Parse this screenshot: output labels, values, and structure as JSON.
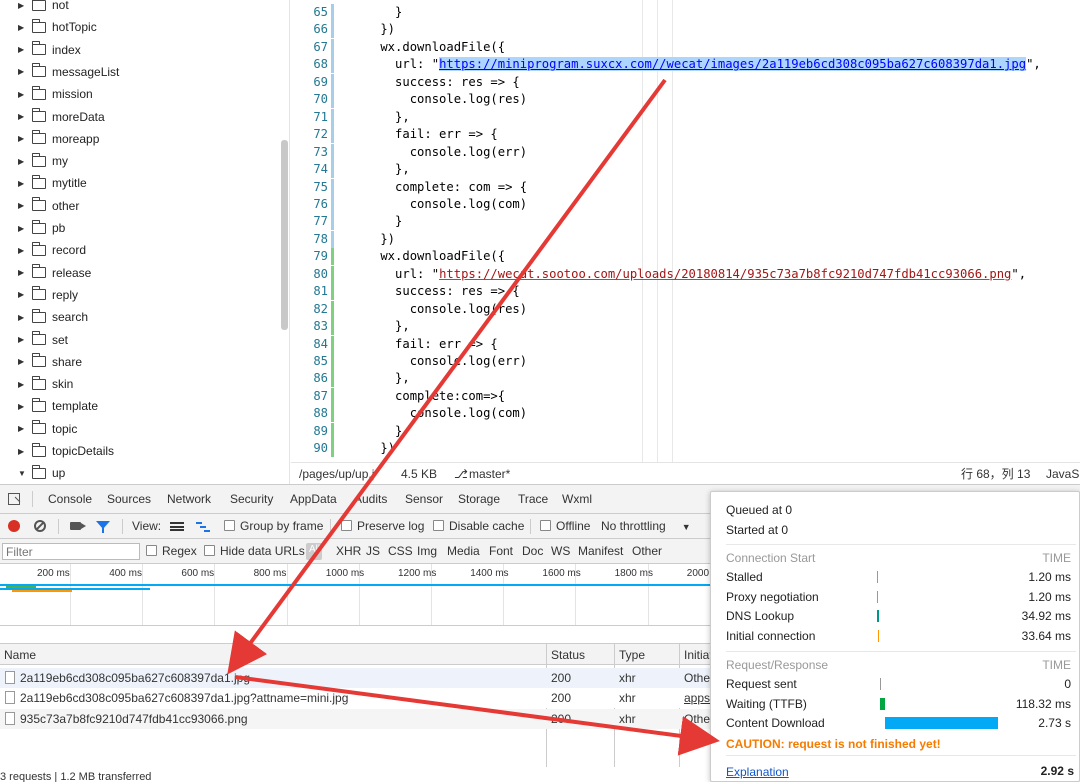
{
  "tree": {
    "items": [
      {
        "label": "not",
        "expanded": false
      },
      {
        "label": "hotTopic",
        "expanded": false
      },
      {
        "label": "index",
        "expanded": false
      },
      {
        "label": "messageList",
        "expanded": false
      },
      {
        "label": "mission",
        "expanded": false
      },
      {
        "label": "moreData",
        "expanded": false
      },
      {
        "label": "moreapp",
        "expanded": false
      },
      {
        "label": "my",
        "expanded": false
      },
      {
        "label": "mytitle",
        "expanded": false
      },
      {
        "label": "other",
        "expanded": false
      },
      {
        "label": "pb",
        "expanded": false
      },
      {
        "label": "record",
        "expanded": false
      },
      {
        "label": "release",
        "expanded": false
      },
      {
        "label": "reply",
        "expanded": false
      },
      {
        "label": "search",
        "expanded": false
      },
      {
        "label": "set",
        "expanded": false
      },
      {
        "label": "share",
        "expanded": false
      },
      {
        "label": "skin",
        "expanded": false
      },
      {
        "label": "template",
        "expanded": false
      },
      {
        "label": "topic",
        "expanded": false
      },
      {
        "label": "topicDetails",
        "expanded": false
      },
      {
        "label": "up",
        "expanded": true
      }
    ]
  },
  "editor": {
    "lines": [
      {
        "num": "65",
        "text": "      }"
      },
      {
        "num": "66",
        "text": "    })"
      },
      {
        "num": "67",
        "text": "    wx.downloadFile({"
      },
      {
        "num": "68",
        "pre": "      url: \"",
        "url": "https://miniprogram.suxcx.com//wecat/images/2a119eb6cd308c095ba627c608397da1.jpg",
        "post": "\","
      },
      {
        "num": "69",
        "text": "      success: res => {"
      },
      {
        "num": "70",
        "text": "        console.log(res)"
      },
      {
        "num": "71",
        "text": "      },"
      },
      {
        "num": "72",
        "text": "      fail: err => {"
      },
      {
        "num": "73",
        "text": "        console.log(err)"
      },
      {
        "num": "74",
        "text": "      },"
      },
      {
        "num": "75",
        "text": "      complete: com => {"
      },
      {
        "num": "76",
        "text": "        console.log(com)"
      },
      {
        "num": "77",
        "text": "      }"
      },
      {
        "num": "78",
        "text": "    })"
      },
      {
        "num": "79",
        "text": "    wx.downloadFile({"
      },
      {
        "num": "80",
        "pre": "      url: \"",
        "url": "https://wecat.sootoo.com/uploads/20180814/935c73a7b8fc9210d747fdb41cc93066.png",
        "post": "\","
      },
      {
        "num": "81",
        "text": "      success: res => {"
      },
      {
        "num": "82",
        "text": "        console.log(res)"
      },
      {
        "num": "83",
        "text": "      },"
      },
      {
        "num": "84",
        "text": "      fail: err => {"
      },
      {
        "num": "85",
        "text": "        console.log(err)"
      },
      {
        "num": "86",
        "text": "      },"
      },
      {
        "num": "87",
        "text": "      complete:com=>{"
      },
      {
        "num": "88",
        "text": "        console.log(com)"
      },
      {
        "num": "89",
        "text": "      }"
      },
      {
        "num": "90",
        "text": "    })"
      }
    ]
  },
  "status": {
    "path": "/pages/up/up.j",
    "size": "4.5 KB",
    "branch": "master*",
    "position": "行 68，列 13",
    "lang": "JavaS"
  },
  "devtools": {
    "tabs": [
      "Console",
      "Sources",
      "Network",
      "Security",
      "AppData",
      "Audits",
      "Sensor",
      "Storage",
      "Trace",
      "Wxml"
    ],
    "active_tab": "Network",
    "toolbar": {
      "view": "View:",
      "group_by_frame": "Group by frame",
      "preserve_log": "Preserve log",
      "disable_cache": "Disable cache",
      "offline": "Offline",
      "throttling": "No throttling"
    },
    "filter": {
      "placeholder": "Filter",
      "regex": "Regex",
      "hide_data_urls": "Hide data URLs",
      "all": "All",
      "types": [
        "XHR",
        "JS",
        "CSS",
        "Img",
        "Media",
        "Font",
        "Doc",
        "WS",
        "Manifest",
        "Other"
      ]
    },
    "ticks": [
      "200 ms",
      "400 ms",
      "600 ms",
      "800 ms",
      "1000 ms",
      "1200 ms",
      "1400 ms",
      "1600 ms",
      "1800 ms",
      "2000 r"
    ],
    "columns": [
      "Name",
      "Status",
      "Type",
      "Initiat"
    ],
    "requests": [
      {
        "name": "2a119eb6cd308c095ba627c608397da1.jpg",
        "status": "200",
        "type": "xhr",
        "initiator": "Othe"
      },
      {
        "name": "2a119eb6cd308c095ba627c608397da1.jpg?attname=mini.jpg",
        "status": "200",
        "type": "xhr",
        "initiator": "apps"
      },
      {
        "name": "935c73a7b8fc9210d747fdb41cc93066.png",
        "status": "200",
        "type": "xhr",
        "initiator": "Othe"
      }
    ],
    "footer": "3 requests | 1.2 MB transferred"
  },
  "timing": {
    "queued": "Queued at 0",
    "started": "Started at 0",
    "connection_header": "Connection Start",
    "time_header": "TIME",
    "connection": [
      {
        "label": "Stalled",
        "value": "1.20 ms"
      },
      {
        "label": "Proxy negotiation",
        "value": "1.20 ms"
      },
      {
        "label": "DNS Lookup",
        "value": "34.92 ms"
      },
      {
        "label": "Initial connection",
        "value": "33.64 ms"
      }
    ],
    "request_header": "Request/Response",
    "request": [
      {
        "label": "Request sent",
        "value": "0"
      },
      {
        "label": "Waiting (TTFB)",
        "value": "118.32 ms"
      },
      {
        "label": "Content Download",
        "value": "2.73 s"
      }
    ],
    "caution": "CAUTION: request is not finished yet!",
    "explanation": "Explanation",
    "total": "2.92 s",
    "colors": {
      "waiting": "#00a63f",
      "download": "#03a9f4",
      "dns": "#009688",
      "initial": "#ff9800",
      "caution": "#f57c00"
    }
  }
}
